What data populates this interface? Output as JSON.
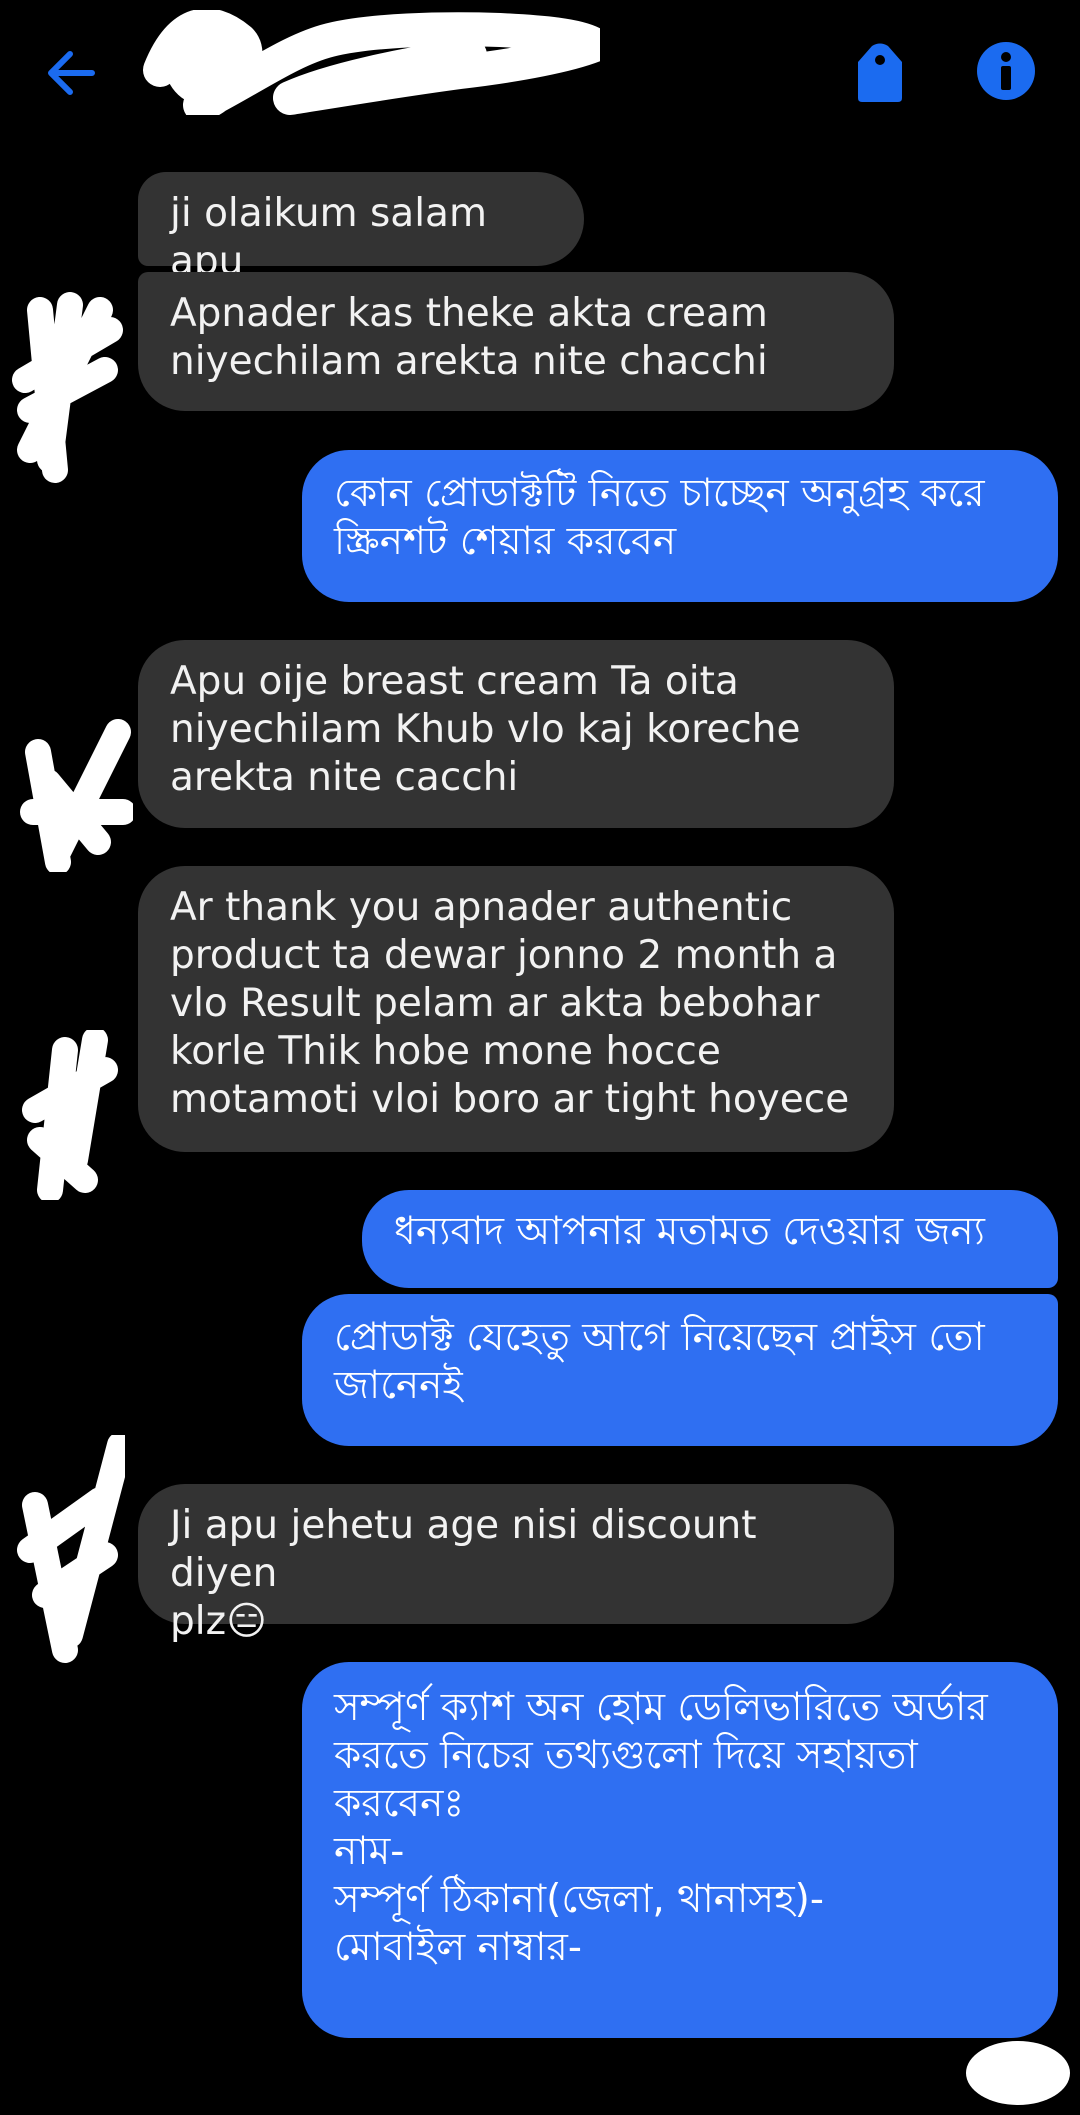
{
  "header": {
    "back_icon": "arrow-left-icon",
    "tag_icon": "tag-icon",
    "info_icon": "info-icon",
    "accent": "#1b6bf0"
  },
  "colors": {
    "background": "#000000",
    "incoming_bubble": "#333333",
    "outgoing_bubble": "#2f6ff2"
  },
  "messages": [
    {
      "side": "incoming",
      "text": "ji olaikum salam apu"
    },
    {
      "side": "incoming",
      "text": "Apnader kas theke akta cream\nniyechilam arekta nite chacchi"
    },
    {
      "side": "outgoing",
      "text": "কোন প্রোডাক্টটি নিতে চাচ্ছেন অনুগ্রহ করে\nস্ক্রিনশট শেয়ার করবেন"
    },
    {
      "side": "incoming",
      "text": "Apu oije breast cream Ta oita\nniyechilam Khub vlo kaj koreche\narekta nite cacchi"
    },
    {
      "side": "incoming",
      "text": "Ar thank you apnader authentic\nproduct ta dewar jonno 2 month a\nvlo Result pelam ar akta bebohar\nkorle Thik hobe mone hocce\nmotamoti vloi boro ar tight hoyece"
    },
    {
      "side": "outgoing",
      "text": "ধন্যবাদ আপনার মতামত দেওয়ার জন্য"
    },
    {
      "side": "outgoing",
      "text": "প্রোডাক্ট যেহেতু আগে নিয়েছেন প্রাইস তো\nজানেনই"
    },
    {
      "side": "incoming",
      "text": "Ji apu jehetu age nisi discount diyen\nplz😑"
    },
    {
      "side": "outgoing",
      "text": "সম্পূর্ণ ক্যাশ অন হোম ডেলিভারিতে অর্ডার\nকরতে নিচের তথ্যগুলো দিয়ে সহায়তা\nকরবেনঃ\nনাম-\nসম্পূর্ণ ঠিকানা(জেলা, থানাসহ)-\nমোবাইল নাম্বার-"
    }
  ]
}
